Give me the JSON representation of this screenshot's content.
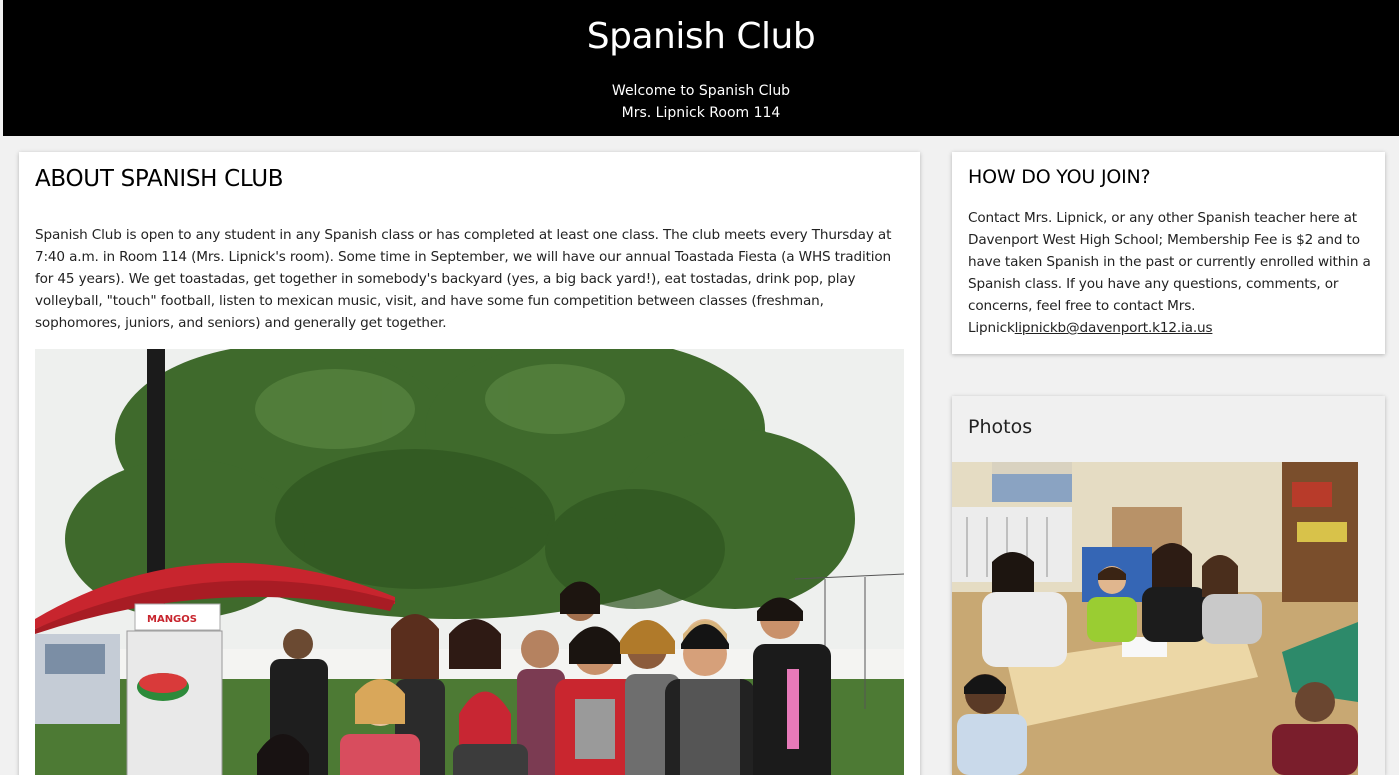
{
  "header": {
    "title": "Spanish Club",
    "line1": "Welcome to Spanish Club",
    "line2": "Mrs. Lipnick Room 114"
  },
  "about": {
    "heading": "ABOUT SPANISH CLUB",
    "body": "Spanish Club is open to any student in any Spanish class or has completed at least one class. The club meets every Thursday at 7:40 a.m. in Room 114 (Mrs. Lipnick's room). Some time in September, we will have our annual Toastada Fiesta (a WHS tradition for 45 years). We get toastadas, get together in somebody's backyard (yes, a big back yard!), eat tostadas, drink pop, play volleyball, \"touch\" football, listen to mexican music, visit, and have some fun competition between classes (freshman, sophomores, juniors, and seniors) and generally get together.",
    "umbrella_sign": "MANGOS"
  },
  "join": {
    "heading": "HOW DO YOU JOIN?",
    "body": "Contact Mrs. Lipnick, or any other Spanish teacher here at Davenport West High School; Membership Fee is $2 and to have taken Spanish in the past or currently enrolled within a Spanish class. If you have any questions, comments, or concerns, feel free to contact Mrs. Lipnick",
    "email": "lipnickb@davenport.k12.ia.us"
  },
  "photos": {
    "heading": "Photos"
  },
  "colors": {
    "header_bg": "#000000",
    "page_bg": "#f1f1f1",
    "umbrella": "#c8252e",
    "tree": "#3f6a2c"
  }
}
